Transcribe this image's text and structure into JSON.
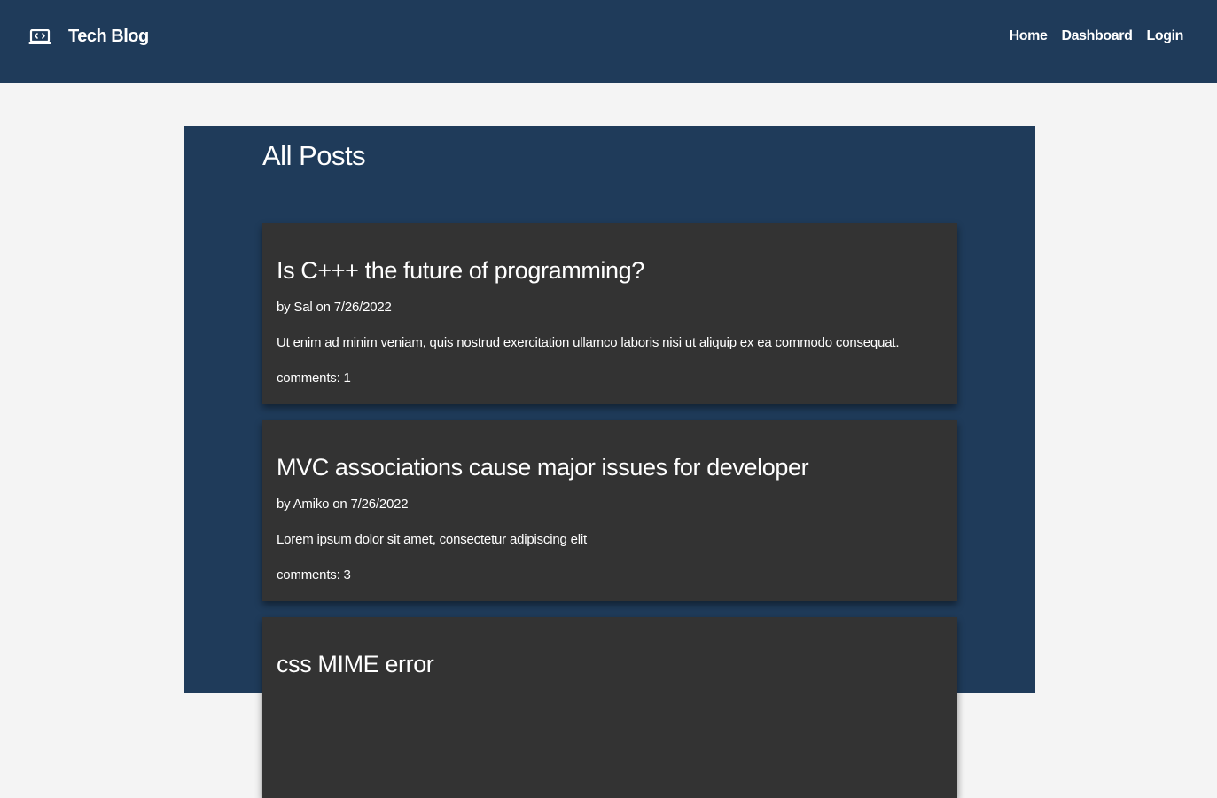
{
  "header": {
    "brand_icon": "laptop-code-icon",
    "title": "Tech Blog",
    "nav": [
      {
        "label": "Home"
      },
      {
        "label": "Dashboard"
      },
      {
        "label": "Login"
      }
    ]
  },
  "main": {
    "title": "All Posts",
    "posts": [
      {
        "title": "Is C+++ the future of programming?",
        "author_line": "by Sal on 7/26/2022",
        "body": "Ut enim ad minim veniam, quis nostrud exercitation ullamco laboris nisi ut aliquip ex ea commodo consequat.",
        "comments": "comments: 1"
      },
      {
        "title": "MVC associations cause major issues for developer",
        "author_line": "by Amiko on 7/26/2022",
        "body": "Lorem ipsum dolor sit amet, consectetur adipiscing elit",
        "comments": "comments: 3"
      },
      {
        "title": "css MIME error",
        "author_line": "",
        "body": "",
        "comments": ""
      }
    ]
  },
  "colors": {
    "header_bg": "#1f3b5a",
    "panel_bg": "#1f3b5a",
    "card_bg": "#333333",
    "page_bg": "#f4f4f4",
    "text": "#ffffff"
  }
}
